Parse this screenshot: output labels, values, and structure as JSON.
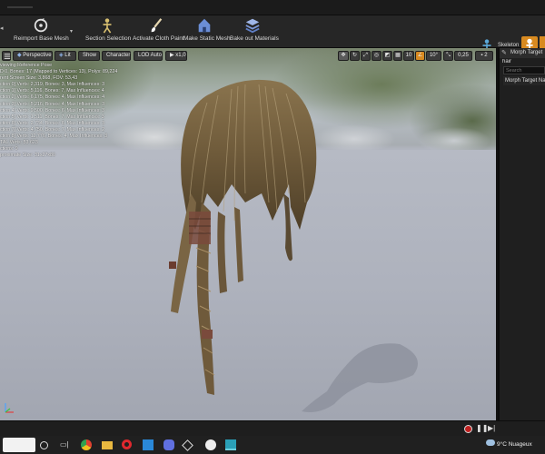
{
  "toolbar": {
    "reimport_base_mesh": "Reimport Base Mesh",
    "section_selection": "Section Selection",
    "activate_cloth_paint": "Activate Cloth Paint",
    "make_static_mesh": "Make Static Mesh",
    "bake_out_materials": "Bake out Materials",
    "skeleton": "Skeleton"
  },
  "viewport": {
    "buttons": {
      "perspective": "Perspective",
      "lit": "Lit",
      "show": "Show",
      "character": "Character",
      "lod": "LOD Auto",
      "speed": "x1,0"
    },
    "right_controls": {
      "grid_snap": "10",
      "rotation_snap": "10°",
      "scale_snap": "0,25",
      "camera_speed": "2"
    },
    "stats": [
      "viewing Reference Pose",
      "D 0, Bones: 17 (Mapped to Vertices: 13), Polys: 89,224",
      "rent Screen Size: 3,868, FOV: 53,43",
      "ction 0] Verts: 2,319, Bones: 3, Max Influences: 3",
      "ction 1] Verts: 5,116, Bones: 7, Max Influences: 4",
      "ction 2] Verts: 6,175, Bones: 4, Max Influences: 4",
      "ction 3] Verts: 5,216, Bones: 4, Max Influences: 3",
      "ction 4] Verts: 9,500, Bones: 6, Max Influences: 3",
      "ction 5] Verts: 1,511, Bones: 7, Max Influences: 3",
      "ction 6] Verts: 2,734, Bones: 6, Max Influences: 3",
      "ction 7] Verts: 4,750, Bones: 7, Max Influences: 2",
      "ction 8] Verts: 12,776, Bones: 4, Max Influences: 3",
      "TAL Verts: 53 623",
      "ctions: 9",
      "proximate Size: 31x27x80"
    ]
  },
  "panel": {
    "tab": "Morph Target",
    "filter": "hair",
    "search_placeholder": "Search",
    "item": "Morph Target Nar"
  },
  "taskbar": {
    "weather": "9°C  Nuageux"
  }
}
